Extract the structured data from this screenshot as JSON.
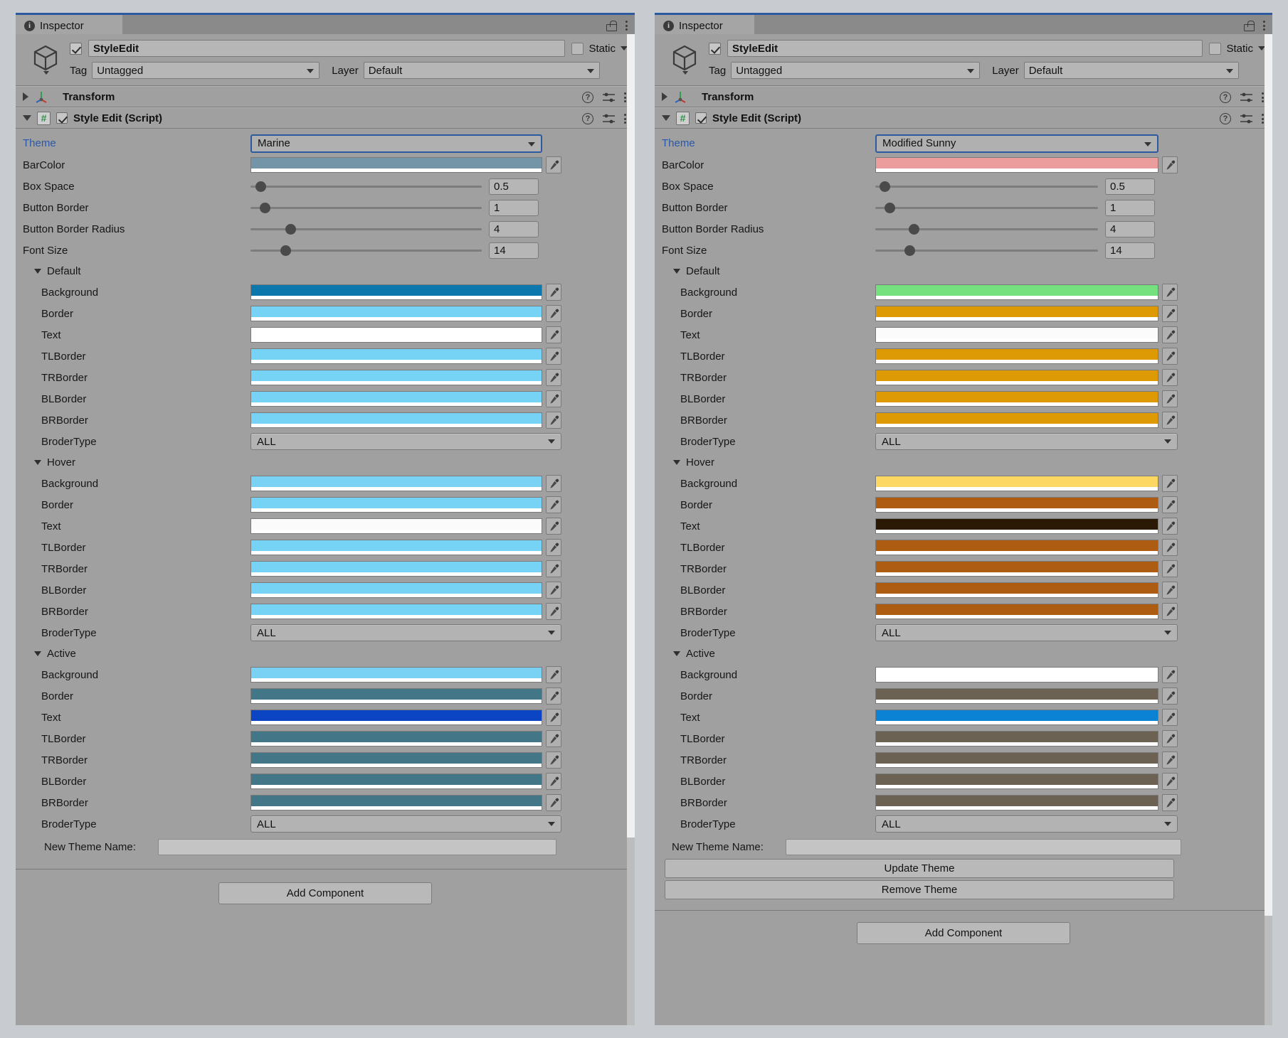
{
  "panels": [
    {
      "id": "left",
      "tab": {
        "label": "Inspector",
        "info_icon": "info-icon",
        "lock_icon": "lock-icon",
        "menu_icon": "kebab-menu-icon"
      },
      "object": {
        "name": "StyleEdit",
        "enabled": true,
        "static_label": "Static",
        "static_checked": false,
        "tag_label": "Tag",
        "tag_value": "Untagged",
        "layer_label": "Layer",
        "layer_value": "Default"
      },
      "components": [
        {
          "title": "Transform",
          "expanded": false,
          "icon": "transform-icon"
        },
        {
          "title": "Style Edit (Script)",
          "expanded": true,
          "icon": "script-icon",
          "enabled": true
        }
      ],
      "theme": {
        "label": "Theme",
        "value": "Marine"
      },
      "bar_color": {
        "label": "BarColor",
        "color": "#7494a8"
      },
      "sliders": [
        {
          "label": "Box Space",
          "value": "0.5",
          "pct": 2
        },
        {
          "label": "Button Border",
          "value": "1",
          "pct": 4
        },
        {
          "label": "Button Border Radius",
          "value": "4",
          "pct": 15
        },
        {
          "label": "Font Size",
          "value": "14",
          "pct": 13
        }
      ],
      "states": [
        {
          "name": "Default",
          "colors": [
            {
              "label": "Background",
              "color": "#0c77ad"
            },
            {
              "label": "Border",
              "color": "#76d3f5"
            },
            {
              "label": "Text",
              "color": "#ffffff"
            },
            {
              "label": "TLBorder",
              "color": "#76d3f5"
            },
            {
              "label": "TRBorder",
              "color": "#76d3f5"
            },
            {
              "label": "BLBorder",
              "color": "#76d3f5"
            },
            {
              "label": "BRBorder",
              "color": "#76d3f5"
            }
          ],
          "border_type": {
            "label": "BroderType",
            "value": "ALL"
          }
        },
        {
          "name": "Hover",
          "colors": [
            {
              "label": "Background",
              "color": "#79d1f4"
            },
            {
              "label": "Border",
              "color": "#76d3f5"
            },
            {
              "label": "Text",
              "color": "#fbfbfb"
            },
            {
              "label": "TLBorder",
              "color": "#76d3f5"
            },
            {
              "label": "TRBorder",
              "color": "#76d3f5"
            },
            {
              "label": "BLBorder",
              "color": "#76d3f5"
            },
            {
              "label": "BRBorder",
              "color": "#76d3f5"
            }
          ],
          "border_type": {
            "label": "BroderType",
            "value": "ALL"
          }
        },
        {
          "name": "Active",
          "colors": [
            {
              "label": "Background",
              "color": "#79d1f4"
            },
            {
              "label": "Border",
              "color": "#437687"
            },
            {
              "label": "Text",
              "color": "#0b45c4"
            },
            {
              "label": "TLBorder",
              "color": "#437687"
            },
            {
              "label": "TRBorder",
              "color": "#437687"
            },
            {
              "label": "BLBorder",
              "color": "#437687"
            },
            {
              "label": "BRBorder",
              "color": "#437687"
            }
          ],
          "border_type": {
            "label": "BroderType",
            "value": "ALL"
          }
        }
      ],
      "new_theme": {
        "label": "New Theme Name:",
        "value": ""
      },
      "buttons": [],
      "add_component_label": "Add Component"
    },
    {
      "id": "right",
      "tab": {
        "label": "Inspector",
        "info_icon": "info-icon",
        "lock_icon": "lock-icon",
        "menu_icon": "kebab-menu-icon"
      },
      "object": {
        "name": "StyleEdit",
        "enabled": true,
        "static_label": "Static",
        "static_checked": false,
        "tag_label": "Tag",
        "tag_value": "Untagged",
        "layer_label": "Layer",
        "layer_value": "Default"
      },
      "components": [
        {
          "title": "Transform",
          "expanded": false,
          "icon": "transform-icon"
        },
        {
          "title": "Style Edit (Script)",
          "expanded": true,
          "icon": "script-icon",
          "enabled": true
        }
      ],
      "theme": {
        "label": "Theme",
        "value": "Modified Sunny"
      },
      "bar_color": {
        "label": "BarColor",
        "color": "#eb9c9c"
      },
      "sliders": [
        {
          "label": "Box Space",
          "value": "0.5",
          "pct": 2
        },
        {
          "label": "Button Border",
          "value": "1",
          "pct": 4
        },
        {
          "label": "Button Border Radius",
          "value": "4",
          "pct": 15
        },
        {
          "label": "Font Size",
          "value": "14",
          "pct": 13
        }
      ],
      "states": [
        {
          "name": "Default",
          "colors": [
            {
              "label": "Background",
              "color": "#74e07e"
            },
            {
              "label": "Border",
              "color": "#dd9a05"
            },
            {
              "label": "Text",
              "color": "#fbfbfb"
            },
            {
              "label": "TLBorder",
              "color": "#dd9a05"
            },
            {
              "label": "TRBorder",
              "color": "#dd9a05"
            },
            {
              "label": "BLBorder",
              "color": "#dd9a05"
            },
            {
              "label": "BRBorder",
              "color": "#dd9a05"
            }
          ],
          "border_type": {
            "label": "BroderType",
            "value": "ALL"
          }
        },
        {
          "name": "Hover",
          "colors": [
            {
              "label": "Background",
              "color": "#fcd762"
            },
            {
              "label": "Border",
              "color": "#ad5c12"
            },
            {
              "label": "Text",
              "color": "#2b1805"
            },
            {
              "label": "TLBorder",
              "color": "#ad5c12"
            },
            {
              "label": "TRBorder",
              "color": "#ad5c12"
            },
            {
              "label": "BLBorder",
              "color": "#ad5c12"
            },
            {
              "label": "BRBorder",
              "color": "#ad5c12"
            }
          ],
          "border_type": {
            "label": "BroderType",
            "value": "ALL"
          }
        },
        {
          "name": "Active",
          "colors": [
            {
              "label": "Background",
              "color": "#ffffff"
            },
            {
              "label": "Border",
              "color": "#6b6253"
            },
            {
              "label": "Text",
              "color": "#0b82d4"
            },
            {
              "label": "TLBorder",
              "color": "#6b6253"
            },
            {
              "label": "TRBorder",
              "color": "#6b6253"
            },
            {
              "label": "BLBorder",
              "color": "#6b6253"
            },
            {
              "label": "BRBorder",
              "color": "#6b6253"
            }
          ],
          "border_type": {
            "label": "BroderType",
            "value": "ALL"
          }
        }
      ],
      "new_theme": {
        "label": "New Theme Name:",
        "value": ""
      },
      "buttons": [
        "Update Theme",
        "Remove Theme"
      ],
      "add_component_label": "Add Component"
    }
  ]
}
